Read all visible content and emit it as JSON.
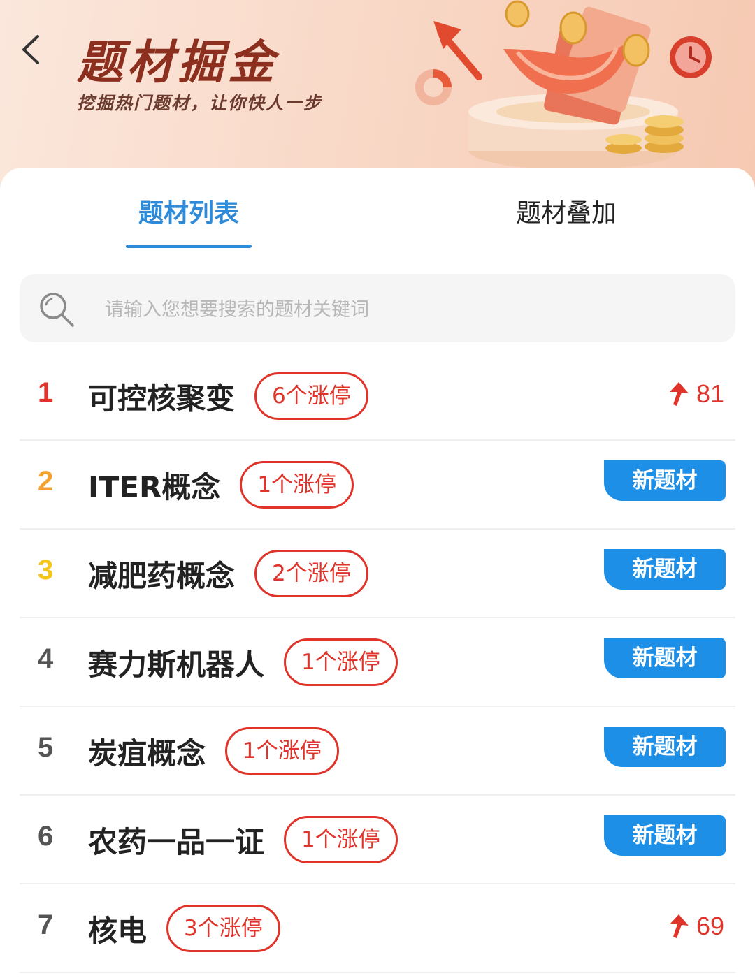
{
  "header": {
    "title": "题材掘金",
    "subtitle": "挖掘热门题材，让你快人一步",
    "back_icon": "chevron-left-icon"
  },
  "tabs": [
    {
      "label": "题材列表",
      "active": true
    },
    {
      "label": "题材叠加",
      "active": false
    }
  ],
  "search": {
    "placeholder": "请输入您想要搜索的题材关键词",
    "value": "",
    "icon": "search-icon"
  },
  "colors": {
    "accent_blue": "#2f8bd8",
    "badge_blue": "#1e8fe6",
    "limit_red": "#e0342b",
    "rank1": "#e0342b",
    "rank2": "#f2a12e",
    "rank3": "#f5c51b",
    "rank_other": "#555555"
  },
  "themes": [
    {
      "rank": "1",
      "name": "可控核聚变",
      "limit_up": "6个涨停",
      "tag": "",
      "heat": "81",
      "trend_icon": "up-arrow-icon"
    },
    {
      "rank": "2",
      "name": "ITER概念",
      "limit_up": "1个涨停",
      "tag": "新题材",
      "heat": ""
    },
    {
      "rank": "3",
      "name": "减肥药概念",
      "limit_up": "2个涨停",
      "tag": "新题材",
      "heat": ""
    },
    {
      "rank": "4",
      "name": "赛力斯机器人",
      "limit_up": "1个涨停",
      "tag": "新题材",
      "heat": ""
    },
    {
      "rank": "5",
      "name": "炭疽概念",
      "limit_up": "1个涨停",
      "tag": "新题材",
      "heat": ""
    },
    {
      "rank": "6",
      "name": "农药一品一证",
      "limit_up": "1个涨停",
      "tag": "新题材",
      "heat": ""
    },
    {
      "rank": "7",
      "name": "核电",
      "limit_up": "3个涨停",
      "tag": "",
      "heat": "69",
      "trend_icon": "up-arrow-icon"
    }
  ]
}
